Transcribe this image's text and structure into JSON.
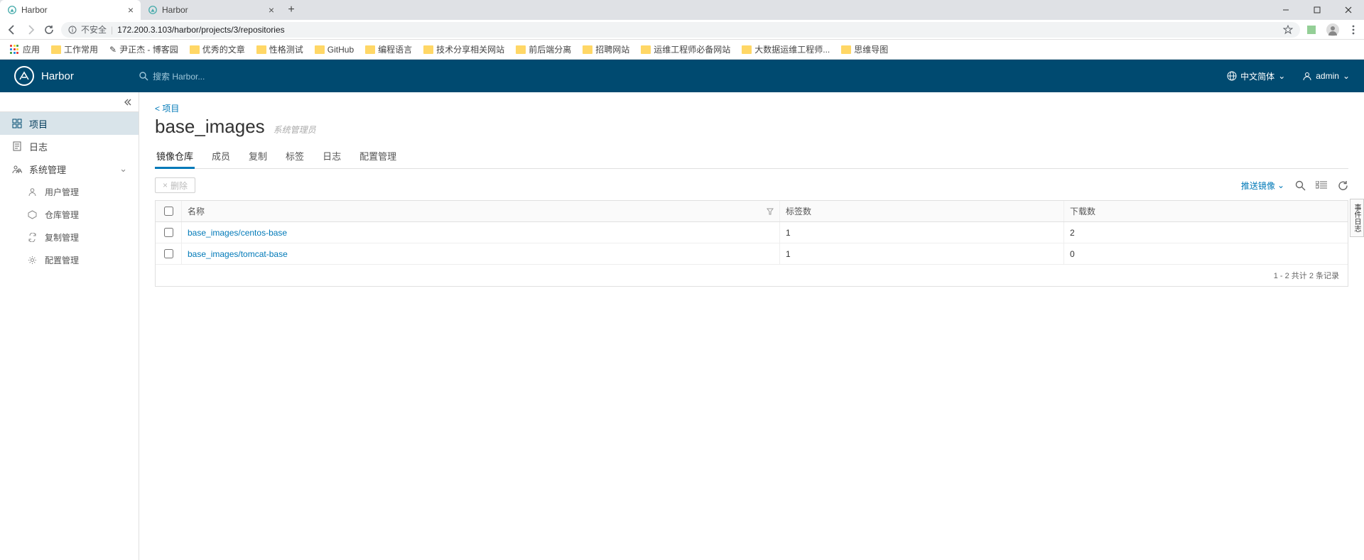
{
  "browser": {
    "tabs": [
      {
        "title": "Harbor",
        "active": true
      },
      {
        "title": "Harbor",
        "active": false
      }
    ],
    "url_insecure": "不安全",
    "url": "172.200.3.103/harbor/projects/3/repositories",
    "bookmarks": {
      "apps": "应用",
      "items": [
        "工作常用",
        "尹正杰 - 博客园",
        "优秀的文章",
        "性格测试",
        "GitHub",
        "编程语言",
        "技术分享相关网站",
        "前后端分离",
        "招聘网站",
        "运维工程师必备网站",
        "大数据运维工程师...",
        "思维导图"
      ]
    }
  },
  "harbor": {
    "brand": "Harbor",
    "search_placeholder": "搜索 Harbor...",
    "lang": "中文简体",
    "user": "admin"
  },
  "sidebar": {
    "project": "项目",
    "logs": "日志",
    "admin": "系统管理",
    "users": "用户管理",
    "repos": "仓库管理",
    "replication": "复制管理",
    "config": "配置管理"
  },
  "main": {
    "breadcrumb": "< 项目",
    "title": "base_images",
    "subtitle": "系统管理员",
    "tabs": [
      "镜像仓库",
      "成员",
      "复制",
      "标签",
      "日志",
      "配置管理"
    ],
    "delete_label": "删除",
    "push_label": "推送镜像",
    "table": {
      "headers": {
        "name": "名称",
        "tags": "标签数",
        "pulls": "下载数"
      },
      "rows": [
        {
          "name": "base_images/centos-base",
          "tags": "1",
          "pulls": "2"
        },
        {
          "name": "base_images/tomcat-base",
          "tags": "1",
          "pulls": "0"
        }
      ],
      "footer": "1 - 2 共计 2 条记录"
    },
    "edge_tab": "事件日志"
  }
}
